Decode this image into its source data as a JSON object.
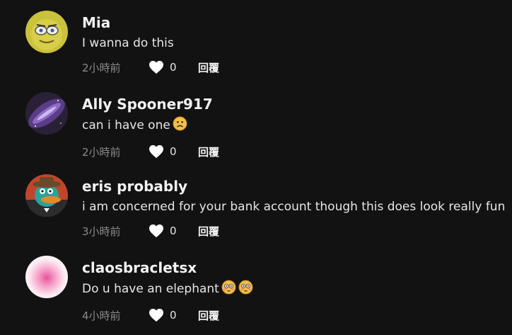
{
  "comments": [
    {
      "username": "Mia",
      "text": "I wanna do this",
      "emojis": [],
      "time": "2小時前",
      "likes": "0",
      "reply": "回覆"
    },
    {
      "username": "Ally Spooner917",
      "text": "can i have one",
      "emojis": [
        "frowning-face"
      ],
      "time": "2小時前",
      "likes": "0",
      "reply": "回覆"
    },
    {
      "username": "eris probably",
      "text": "i am concerned for your bank account though this does look really fun",
      "emojis": [],
      "time": "3小時前",
      "likes": "0",
      "reply": "回覆"
    },
    {
      "username": "claosbracletsx",
      "text": "Do u have an elephant",
      "emojis": [
        "flushed-face",
        "flushed-face"
      ],
      "time": "4小時前",
      "likes": "0",
      "reply": "回覆"
    }
  ],
  "colors": {
    "background": "#121212",
    "text": "#e6e6e6",
    "muted": "#8a8a8a",
    "emoji": "#f2c14e"
  }
}
